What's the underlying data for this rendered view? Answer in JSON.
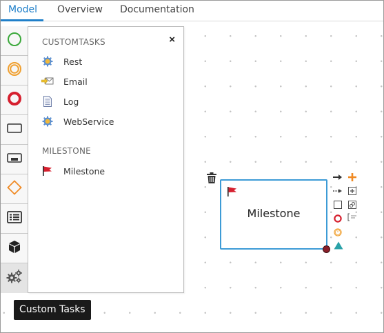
{
  "tabs": [
    {
      "label": "Model",
      "active": true
    },
    {
      "label": "Overview",
      "active": false
    },
    {
      "label": "Documentation",
      "active": false
    }
  ],
  "palette": {
    "items": [
      {
        "name": "start-event",
        "icon": "green-circle-icon"
      },
      {
        "name": "intermediate-event",
        "icon": "orange-double-circle-icon"
      },
      {
        "name": "end-event",
        "icon": "red-thick-circle-icon"
      },
      {
        "name": "task",
        "icon": "rectangle-icon"
      },
      {
        "name": "subprocess",
        "icon": "collapsed-subprocess-icon"
      },
      {
        "name": "gateway",
        "icon": "orange-diamond-icon"
      },
      {
        "name": "data-object",
        "icon": "list-card-icon"
      },
      {
        "name": "artifact",
        "icon": "cube-icon"
      },
      {
        "name": "custom-tasks",
        "icon": "gears-icon"
      }
    ]
  },
  "popover": {
    "close_label": "×",
    "sections": [
      {
        "title": "CUSTOMTASKS",
        "items": [
          {
            "label": "Rest",
            "icon": "gear-sun-icon"
          },
          {
            "label": "Email",
            "icon": "email-arrow-icon"
          },
          {
            "label": "Log",
            "icon": "document-icon"
          },
          {
            "label": "WebService",
            "icon": "gear-sun-icon"
          }
        ]
      },
      {
        "title": "MILESTONE",
        "items": [
          {
            "label": "Milestone",
            "icon": "red-flag-icon"
          }
        ]
      }
    ]
  },
  "node": {
    "label": "Milestone",
    "border_color": "#3d9bd6"
  },
  "tooltip": {
    "text": "Custom Tasks"
  },
  "colors": {
    "accent": "#1f7fc9",
    "start_event": "#3aa83a",
    "intermediate_event": "#f0a030",
    "end_event": "#d6202f",
    "gateway": "#f08a24",
    "add_action": "#f08a24",
    "triangle_action": "#2aa2a8"
  }
}
